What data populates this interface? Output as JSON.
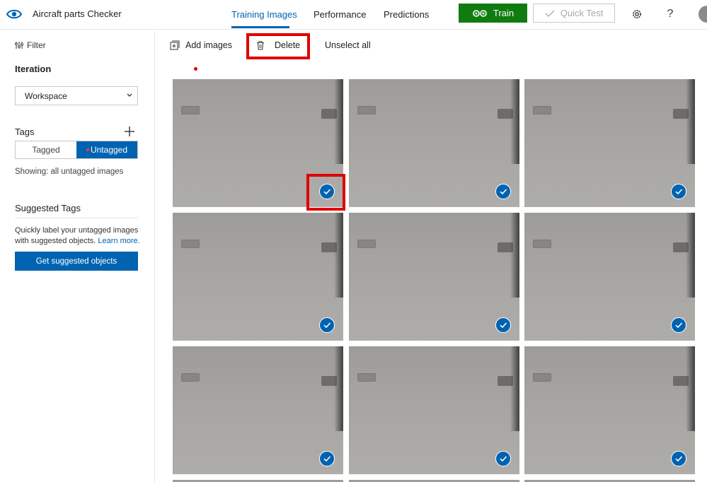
{
  "app": {
    "title": "Aircraft parts Checker"
  },
  "nav": {
    "tabs": [
      {
        "label": "Training Images",
        "active": true
      },
      {
        "label": "Performance",
        "active": false
      },
      {
        "label": "Predictions",
        "active": false
      }
    ],
    "train_label": "Train",
    "quick_test_label": "Quick Test",
    "settings_icon": "gear-icon",
    "help_label": "?"
  },
  "sidebar": {
    "filter_label": "Filter",
    "iteration_title": "Iteration",
    "iteration_value": "Workspace",
    "tags_title": "Tags",
    "tag_tabs": [
      "Tagged",
      "Untagged"
    ],
    "active_tag_tab": "Untagged",
    "showing_text": "Showing: all untagged images",
    "suggested_title": "Suggested Tags",
    "suggested_desc": "Quickly label your untagged images with suggested objects.",
    "learn_more": "Learn more.",
    "suggest_button": "Get suggested objects"
  },
  "toolbar": {
    "add_images": "Add images",
    "delete": "Delete",
    "unselect_all": "Unselect all"
  },
  "images": {
    "count_visible": 9,
    "selected": [
      true,
      true,
      true,
      true,
      true,
      true,
      true,
      true,
      true
    ]
  },
  "colors": {
    "accent": "#0063b1",
    "train": "#107c10",
    "highlight": "#e00000"
  }
}
